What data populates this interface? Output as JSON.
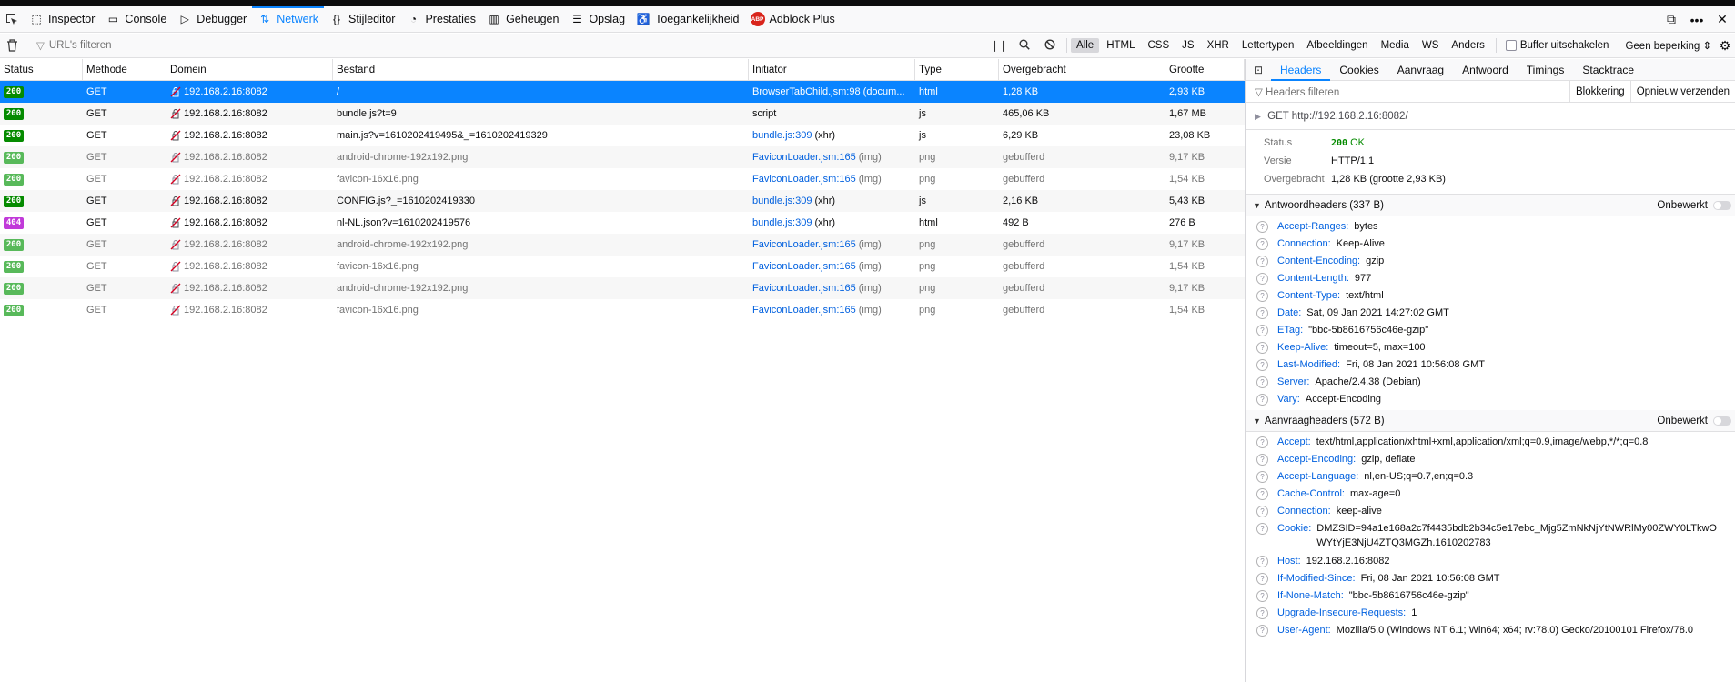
{
  "toolbar": {
    "tabs": [
      {
        "label": "Inspector",
        "icon": "inspector-icon"
      },
      {
        "label": "Console",
        "icon": "console-icon"
      },
      {
        "label": "Debugger",
        "icon": "debugger-icon"
      },
      {
        "label": "Netwerk",
        "icon": "network-icon",
        "active": true
      },
      {
        "label": "Stijleditor",
        "icon": "style-editor-icon"
      },
      {
        "label": "Prestaties",
        "icon": "performance-icon"
      },
      {
        "label": "Geheugen",
        "icon": "memory-icon"
      },
      {
        "label": "Opslag",
        "icon": "storage-icon"
      },
      {
        "label": "Toegankelijkheid",
        "icon": "accessibility-icon"
      },
      {
        "label": "Adblock Plus",
        "icon": "abp-icon"
      }
    ],
    "abp_text": "ABP"
  },
  "filterbar": {
    "url_placeholder": "URL's filteren",
    "types": [
      "Alle",
      "HTML",
      "CSS",
      "JS",
      "XHR",
      "Lettertypen",
      "Afbeeldingen",
      "Media",
      "WS",
      "Anders"
    ],
    "cache_label": "Buffer uitschakelen",
    "throttle": "Geen beperking ⇕"
  },
  "columns": [
    "Status",
    "Methode",
    "Domein",
    "Bestand",
    "Initiator",
    "Type",
    "Overgebracht",
    "Grootte"
  ],
  "requests": [
    {
      "status": "200",
      "method": "GET",
      "domain": "192.168.2.16:8082",
      "file": "/",
      "initiator": "BrowserTabChild.jsm:98 (docum...",
      "init_note": "",
      "type": "html",
      "transferred": "1,28 KB",
      "size": "2,93 KB",
      "selected": true,
      "cached": false
    },
    {
      "status": "200",
      "method": "GET",
      "domain": "192.168.2.16:8082",
      "file": "bundle.js?t=9",
      "initiator": "script",
      "init_note": "",
      "type": "js",
      "transferred": "465,06 KB",
      "size": "1,67 MB",
      "selected": false,
      "cached": false
    },
    {
      "status": "200",
      "method": "GET",
      "domain": "192.168.2.16:8082",
      "file": "main.js?v=1610202419495&_=1610202419329",
      "initiator": "bundle.js:309",
      "init_note": "(xhr)",
      "type": "js",
      "transferred": "6,29 KB",
      "size": "23,08 KB",
      "selected": false,
      "cached": false
    },
    {
      "status": "200",
      "method": "GET",
      "domain": "192.168.2.16:8082",
      "file": "android-chrome-192x192.png",
      "initiator": "FaviconLoader.jsm:165",
      "init_note": "(img)",
      "type": "png",
      "transferred": "gebufferd",
      "size": "9,17 KB",
      "selected": false,
      "cached": true
    },
    {
      "status": "200",
      "method": "GET",
      "domain": "192.168.2.16:8082",
      "file": "favicon-16x16.png",
      "initiator": "FaviconLoader.jsm:165",
      "init_note": "(img)",
      "type": "png",
      "transferred": "gebufferd",
      "size": "1,54 KB",
      "selected": false,
      "cached": true
    },
    {
      "status": "200",
      "method": "GET",
      "domain": "192.168.2.16:8082",
      "file": "CONFIG.js?_=1610202419330",
      "initiator": "bundle.js:309",
      "init_note": "(xhr)",
      "type": "js",
      "transferred": "2,16 KB",
      "size": "5,43 KB",
      "selected": false,
      "cached": false
    },
    {
      "status": "404",
      "method": "GET",
      "domain": "192.168.2.16:8082",
      "file": "nl-NL.json?v=1610202419576",
      "initiator": "bundle.js:309",
      "init_note": "(xhr)",
      "type": "html",
      "transferred": "492 B",
      "size": "276 B",
      "selected": false,
      "cached": false
    },
    {
      "status": "200",
      "method": "GET",
      "domain": "192.168.2.16:8082",
      "file": "android-chrome-192x192.png",
      "initiator": "FaviconLoader.jsm:165",
      "init_note": "(img)",
      "type": "png",
      "transferred": "gebufferd",
      "size": "9,17 KB",
      "selected": false,
      "cached": true
    },
    {
      "status": "200",
      "method": "GET",
      "domain": "192.168.2.16:8082",
      "file": "favicon-16x16.png",
      "initiator": "FaviconLoader.jsm:165",
      "init_note": "(img)",
      "type": "png",
      "transferred": "gebufferd",
      "size": "1,54 KB",
      "selected": false,
      "cached": true
    },
    {
      "status": "200",
      "method": "GET",
      "domain": "192.168.2.16:8082",
      "file": "android-chrome-192x192.png",
      "initiator": "FaviconLoader.jsm:165",
      "init_note": "(img)",
      "type": "png",
      "transferred": "gebufferd",
      "size": "9,17 KB",
      "selected": false,
      "cached": true
    },
    {
      "status": "200",
      "method": "GET",
      "domain": "192.168.2.16:8082",
      "file": "favicon-16x16.png",
      "initiator": "FaviconLoader.jsm:165",
      "init_note": "(img)",
      "type": "png",
      "transferred": "gebufferd",
      "size": "1,54 KB",
      "selected": false,
      "cached": true
    }
  ],
  "panel": {
    "tabs": [
      "Headers",
      "Cookies",
      "Aanvraag",
      "Antwoord",
      "Timings",
      "Stacktrace"
    ],
    "filter_placeholder": "Headers filteren",
    "block_button": "Blokkering",
    "resend_button": "Opnieuw verzenden",
    "request_method": "GET",
    "request_url": "http://192.168.2.16:8082/",
    "summary": {
      "status_label": "Status",
      "status_code": "200",
      "status_text": "OK",
      "version_label": "Versie",
      "version": "HTTP/1.1",
      "transferred_label": "Overgebracht",
      "transferred": "1,28 KB (grootte 2,93 KB)"
    },
    "response_section": {
      "title": "Antwoordheaders (337 B)",
      "raw_label": "Onbewerkt"
    },
    "response_headers": [
      {
        "k": "Accept-Ranges:",
        "v": "bytes"
      },
      {
        "k": "Connection:",
        "v": "Keep-Alive"
      },
      {
        "k": "Content-Encoding:",
        "v": "gzip"
      },
      {
        "k": "Content-Length:",
        "v": "977"
      },
      {
        "k": "Content-Type:",
        "v": "text/html"
      },
      {
        "k": "Date:",
        "v": "Sat, 09 Jan 2021 14:27:02 GMT"
      },
      {
        "k": "ETag:",
        "v": "\"bbc-5b8616756c46e-gzip\""
      },
      {
        "k": "Keep-Alive:",
        "v": "timeout=5, max=100"
      },
      {
        "k": "Last-Modified:",
        "v": "Fri, 08 Jan 2021 10:56:08 GMT"
      },
      {
        "k": "Server:",
        "v": "Apache/2.4.38 (Debian)"
      },
      {
        "k": "Vary:",
        "v": "Accept-Encoding"
      }
    ],
    "request_section": {
      "title": "Aanvraagheaders (572 B)",
      "raw_label": "Onbewerkt"
    },
    "request_headers": [
      {
        "k": "Accept:",
        "v": "text/html,application/xhtml+xml,application/xml;q=0.9,image/webp,*/*;q=0.8"
      },
      {
        "k": "Accept-Encoding:",
        "v": "gzip, deflate"
      },
      {
        "k": "Accept-Language:",
        "v": "nl,en-US;q=0.7,en;q=0.3"
      },
      {
        "k": "Cache-Control:",
        "v": "max-age=0"
      },
      {
        "k": "Connection:",
        "v": "keep-alive"
      },
      {
        "k": "Cookie:",
        "v": "DMZSID=94a1e168a2c7f4435bdb2b34c5e17ebc_Mjg5ZmNkNjYtNWRlMy00ZWY0LTkwOWYtYjE3NjU4ZTQ3MGZh.1610202783",
        "tall": true
      },
      {
        "k": "Host:",
        "v": "192.168.2.16:8082"
      },
      {
        "k": "If-Modified-Since:",
        "v": "Fri, 08 Jan 2021 10:56:08 GMT"
      },
      {
        "k": "If-None-Match:",
        "v": "\"bbc-5b8616756c46e-gzip\""
      },
      {
        "k": "Upgrade-Insecure-Requests:",
        "v": "1"
      },
      {
        "k": "User-Agent:",
        "v": "Mozilla/5.0 (Windows NT 6.1; Win64; x64; rv:78.0) Gecko/20100101 Firefox/78.0"
      }
    ]
  },
  "colors": {
    "accent": "#0a84ff",
    "ok": "#058b00",
    "not_found": "#c13ad9",
    "link": "#0060df"
  }
}
